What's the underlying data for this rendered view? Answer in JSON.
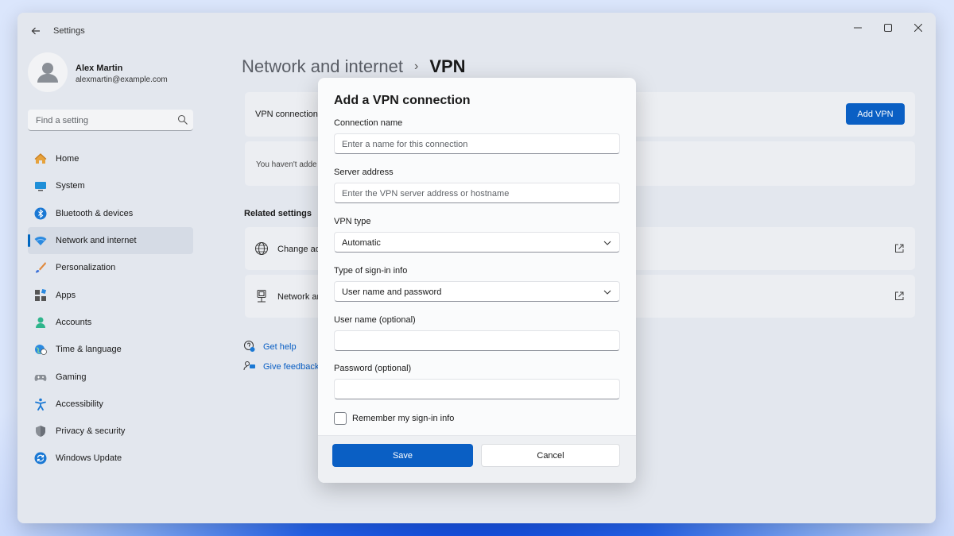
{
  "window": {
    "title": "Settings"
  },
  "profile": {
    "name": "Alex Martin",
    "email": "alexmartin@example.com"
  },
  "search": {
    "placeholder": "Find a setting"
  },
  "nav": [
    {
      "label": "Home",
      "icon": "home-icon"
    },
    {
      "label": "System",
      "icon": "system-icon"
    },
    {
      "label": "Bluetooth & devices",
      "icon": "bluetooth-icon"
    },
    {
      "label": "Network and internet",
      "icon": "wifi-icon",
      "active": true
    },
    {
      "label": "Personalization",
      "icon": "brush-icon"
    },
    {
      "label": "Apps",
      "icon": "apps-icon"
    },
    {
      "label": "Accounts",
      "icon": "accounts-icon"
    },
    {
      "label": "Time & language",
      "icon": "globe-clock-icon"
    },
    {
      "label": "Gaming",
      "icon": "gamepad-icon"
    },
    {
      "label": "Accessibility",
      "icon": "accessibility-icon"
    },
    {
      "label": "Privacy & security",
      "icon": "shield-icon"
    },
    {
      "label": "Windows Update",
      "icon": "update-icon"
    }
  ],
  "breadcrumb": {
    "parent": "Network and internet",
    "separator": "›",
    "current": "VPN"
  },
  "main": {
    "vpn_connections_label": "VPN connection",
    "add_vpn_label": "Add VPN",
    "empty_text": "You haven't adde",
    "related_settings_title": "Related settings",
    "related": [
      {
        "label": "Change ad",
        "icon": "globe-icon"
      },
      {
        "label": "Network ar",
        "icon": "network-adapter-icon"
      }
    ],
    "get_help": "Get help",
    "give_feedback": "Give feedback"
  },
  "dialog": {
    "title": "Add a VPN connection",
    "connection_name_label": "Connection name",
    "connection_name_placeholder": "Enter a name for this connection",
    "server_address_label": "Server address",
    "server_address_placeholder": "Enter the VPN server address or hostname",
    "vpn_type_label": "VPN type",
    "vpn_type_value": "Automatic",
    "signin_type_label": "Type of sign-in info",
    "signin_type_value": "User name and password",
    "username_label": "User name (optional)",
    "username_value": "",
    "password_label": "Password (optional)",
    "password_value": "",
    "remember_label": "Remember my sign-in info",
    "remember_checked": false,
    "save_label": "Save",
    "cancel_label": "Cancel"
  },
  "colors": {
    "accent": "#0a5fc4",
    "window_bg": "#e3e7ee",
    "dialog_bg": "#fafbfc"
  }
}
